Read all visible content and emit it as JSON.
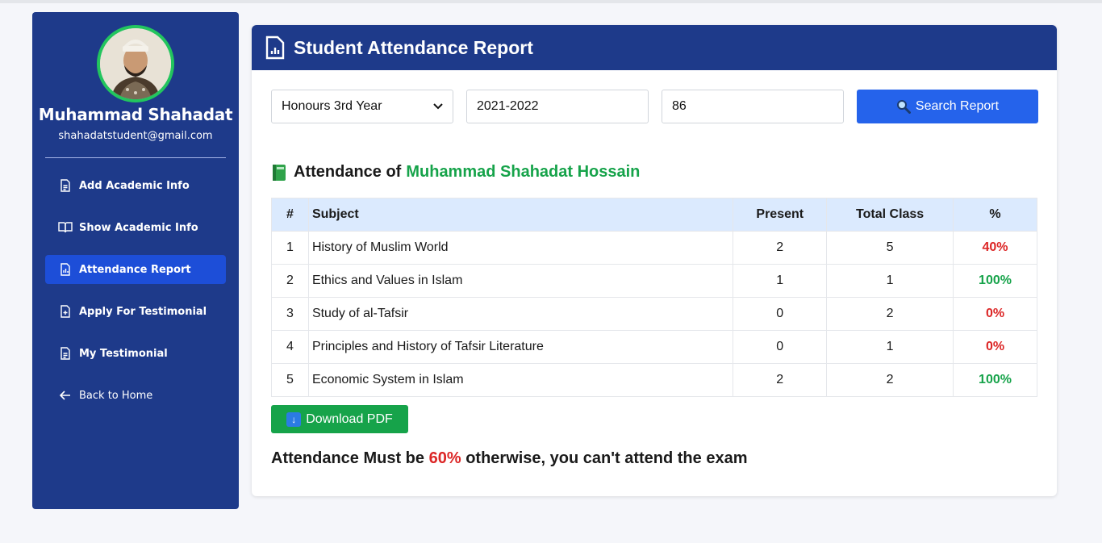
{
  "profile": {
    "name": "Muhammad Shahadat",
    "email": "shahadatstudent@gmail.com"
  },
  "sidebar": {
    "items": [
      {
        "label": "Add Academic Info",
        "icon": "document-icon"
      },
      {
        "label": "Show Academic Info",
        "icon": "book-open-icon"
      },
      {
        "label": "Attendance Report",
        "icon": "report-chart-icon",
        "active": true
      },
      {
        "label": "Apply For Testimonial",
        "icon": "document-plus-icon"
      },
      {
        "label": "My Testimonial",
        "icon": "document-icon"
      },
      {
        "label": "Back to Home",
        "icon": "arrow-left-icon"
      }
    ]
  },
  "header": {
    "title": "Student Attendance Report",
    "icon": "report-chart-icon"
  },
  "filters": {
    "year_selected": "Honours 3rd Year",
    "session": "2021-2022",
    "roll": "86",
    "search_label": "Search Report"
  },
  "attendance": {
    "prefix": "Attendance of",
    "student_name": "Muhammad Shahadat Hossain"
  },
  "table": {
    "headers": [
      "#",
      "Subject",
      "Present",
      "Total Class",
      "%"
    ],
    "rows": [
      {
        "num": "1",
        "subject": "History of Muslim World",
        "present": "2",
        "total": "5",
        "pct": "40%"
      },
      {
        "num": "2",
        "subject": "Ethics and Values in Islam",
        "present": "1",
        "total": "1",
        "pct": "100%"
      },
      {
        "num": "3",
        "subject": "Study of al-Tafsir",
        "present": "0",
        "total": "2",
        "pct": "0%"
      },
      {
        "num": "4",
        "subject": "Principles and History of Tafsir Literature",
        "present": "0",
        "total": "1",
        "pct": "0%"
      },
      {
        "num": "5",
        "subject": "Economic System in Islam",
        "present": "2",
        "total": "2",
        "pct": "100%"
      }
    ]
  },
  "download_label": "Download PDF",
  "notice": {
    "before": "Attendance Must be",
    "threshold": "60%",
    "after": "otherwise, you can't attend the exam"
  },
  "colors": {
    "sidebar": "#1e3a8a",
    "active": "#1d4ed8",
    "primary": "#2563eb",
    "success": "#16a34a",
    "danger": "#dc2626"
  }
}
